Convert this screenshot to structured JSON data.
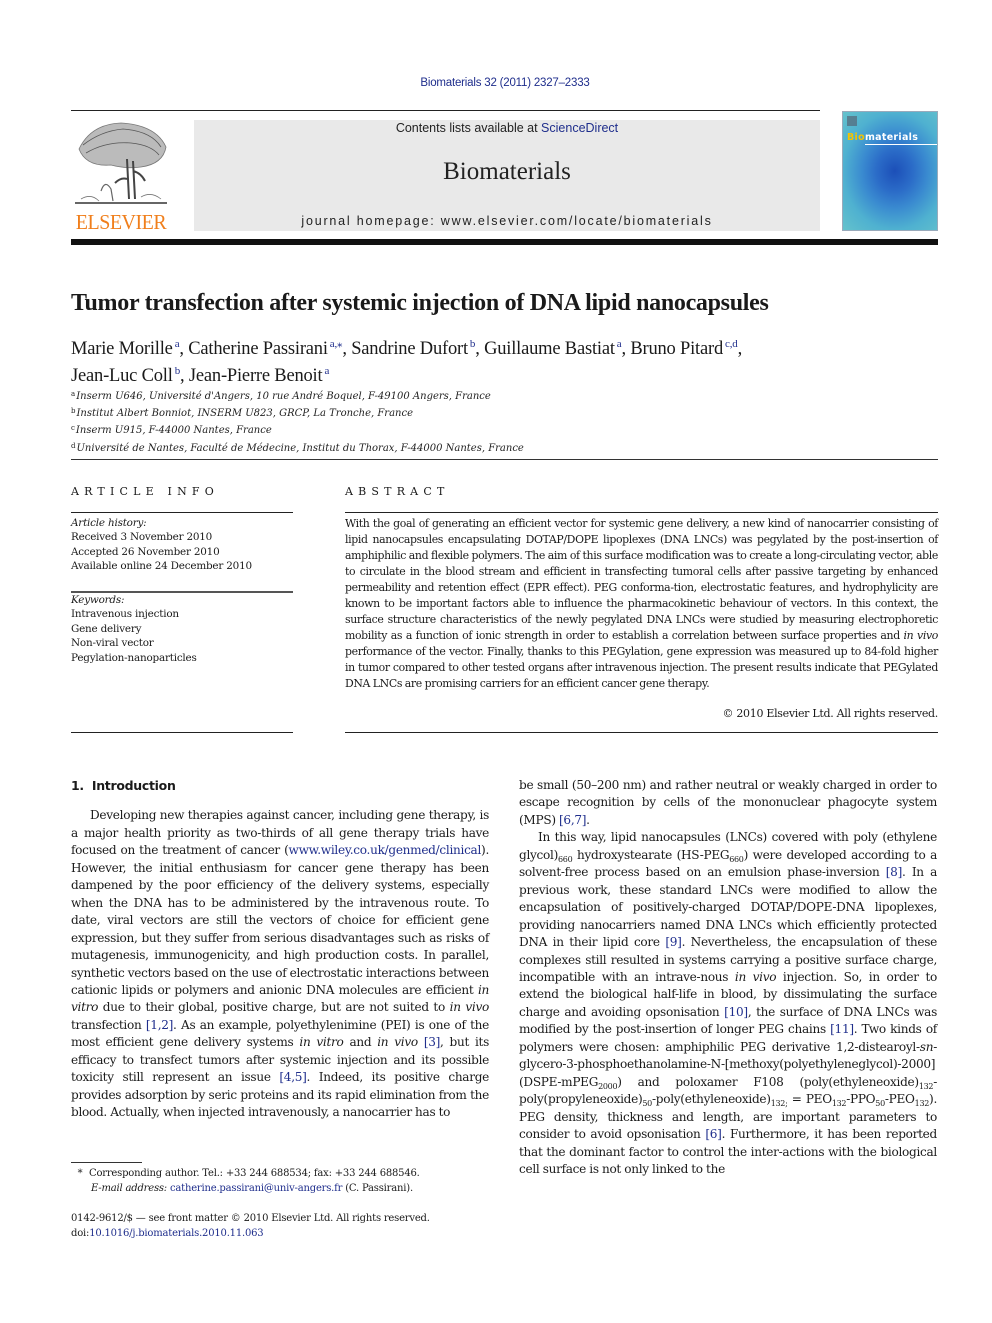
{
  "header": {
    "citation": "Biomaterials 32 (2011) 2327–2333",
    "contents_prefix": "Contents lists available at ",
    "contents_link": "ScienceDirect",
    "journal_name": "Biomaterials",
    "homepage_prefix": "journal homepage: ",
    "homepage_url": "www.elsevier.com/locate/biomaterials",
    "publisher_logo_text": "ELSEVIER",
    "cover_title_a": "Bio",
    "cover_title_b": "materials",
    "colors": {
      "publisher_orange": "#f07f1c",
      "link_blue": "#1f2e8c",
      "header_gray": "#e9e9e9",
      "cover_blue": "#2b6cc8"
    }
  },
  "article": {
    "title": "Tumor transfection after systemic injection of DNA lipid nanocapsules",
    "authors": [
      {
        "name": "Marie Morille",
        "aff": "a"
      },
      {
        "name": "Catherine Passirani",
        "aff": "a,⁎"
      },
      {
        "name": "Sandrine Dufort",
        "aff": "b"
      },
      {
        "name": "Guillaume Bastiat",
        "aff": "a"
      },
      {
        "name": "Bruno Pitard",
        "aff": "c,d"
      },
      {
        "name": "Jean-Luc Coll",
        "aff": "b"
      },
      {
        "name": "Jean-Pierre Benoit",
        "aff": "a"
      }
    ],
    "affiliations": [
      {
        "key": "a",
        "text": "Inserm U646, Université d'Angers, 10 rue André Boquel, F-49100 Angers, France"
      },
      {
        "key": "b",
        "text": "Institut Albert Bonniot, INSERM U823, GRCP, La Tronche, France"
      },
      {
        "key": "c",
        "text": "Inserm U915, F-44000 Nantes, France"
      },
      {
        "key": "d",
        "text": "Université de Nantes, Faculté de Médecine, Institut du Thorax, F-44000 Nantes, France"
      }
    ]
  },
  "article_info": {
    "heading": "ARTICLE INFO",
    "history_label": "Article history:",
    "history": [
      "Received 3 November 2010",
      "Accepted 26 November 2010",
      "Available online 24 December 2010"
    ],
    "keywords_label": "Keywords:",
    "keywords": [
      "Intravenous injection",
      "Gene delivery",
      "Non-viral vector",
      "Pegylation-nanoparticles"
    ]
  },
  "abstract": {
    "heading": "ABSTRACT",
    "text_1": "With the goal of generating an efficient vector for systemic gene delivery, a new kind of nanocarrier consisting of lipid nanocapsules encapsulating DOTAP/DOPE lipoplexes (DNA LNCs) was pegylated by the post-insertion of amphiphilic and flexible polymers. The aim of this surface modification was to create a long-circulating vector, able to circulate in the blood stream and efficient in transfecting tumoral cells after passive targeting by enhanced permeability and retention effect (EPR effect). PEG conforma-tion, electrostatic features, and hydrophylicity are known to be important factors able to influence the pharmacokinetic behaviour of vectors. In this context, the surface structure characteristics of the newly pegylated DNA LNCs were studied by measuring electrophoretic mobility as a function of ionic strength in order to establish a correlation between surface properties and ",
    "text_italic": "in vivo",
    "text_2": " performance of the vector. Finally, thanks to this PEGylation, gene expression was measured up to 84-fold higher in tumor compared to other tested organs after intravenous injection. The present results indicate that PEGylated DNA LNCs are promising carriers for an efficient cancer gene therapy.",
    "copyright": "© 2010 Elsevier Ltd. All rights reserved."
  },
  "intro": {
    "number": "1.",
    "heading": "Introduction",
    "left": {
      "t1": "Developing new therapies against cancer, including gene therapy, is a major health priority as two-thirds of all gene therapy trials have focused on the treatment of cancer (",
      "link1": "www.wiley.co.uk/genmed/clinical",
      "t2": "). However, the initial enthusiasm for cancer gene therapy has been dampened by the poor efficiency of the delivery systems, especially when the DNA has to be administered by the intravenous route. To date, viral vectors are still the vectors of choice for efficient gene expression, but they suffer from serious disadvantages such as risks of mutagenesis, immunogenicity, and high production costs. In parallel, synthetic vectors based on the use of electrostatic interactions between cationic lipids or polymers and anionic DNA molecules are efficient ",
      "i1": "in vitro",
      "t3": " due to their global, positive charge, but are not suited to ",
      "i2": "in vivo",
      "t4": " transfection ",
      "ref1": "[1,2]",
      "t5": ". As an example, polyethylenimine (PEI) is one of the most efficient gene delivery systems ",
      "i3": "in vitro",
      "t6": " and ",
      "i4": "in vivo",
      "t7": " ",
      "ref2": "[3]",
      "t8": ", but its efficacy to transfect tumors after systemic injection and its possible toxicity still represent an issue ",
      "ref3": "[4,5]",
      "t9": ". Indeed, its positive charge provides adsorption by seric proteins and its rapid elimination from the blood. Actually, when injected intravenously, a nanocarrier has to"
    },
    "right": {
      "p1_t1": "be small (50–200 nm) and rather neutral or weakly charged in order to escape recognition by cells of the mononuclear phagocyte system (MPS) ",
      "p1_ref": "[6,7]",
      "p1_t2": ".",
      "p2_t1": "In this way, lipid nanocapsules (LNCs) covered with poly (ethylene glycol)",
      "p2_s1": "660",
      "p2_t2": " hydroxystearate (HS-PEG",
      "p2_s2": "660",
      "p2_t3": ") were developed according to a solvent-free process based on an emulsion phase-inversion ",
      "p2_ref1": "[8]",
      "p2_t4": ". In a previous work, these standard LNCs were modified to allow the encapsulation of positively-charged DOTAP/DOPE-DNA lipoplexes, providing nanocarriers named DNA LNCs which efficiently protected DNA in their lipid core ",
      "p2_ref2": "[9]",
      "p2_t5": ". Nevertheless, the encapsulation of these complexes still resulted in systems carrying a positive surface charge, incompatible with an intrave-nous ",
      "p2_i1": "in vivo",
      "p2_t6": " injection. So, in order to extend the biological half-life in blood, by dissimulating the surface charge and avoiding opsonisation ",
      "p2_ref3": "[10]",
      "p2_t7": ", the surface of DNA LNCs was modified by the post-insertion of longer PEG chains ",
      "p2_ref4": "[11]",
      "p2_t8": ". Two kinds of polymers were chosen: amphiphilic PEG derivative 1,2-distearoyl-",
      "p2_i2": "sn",
      "p2_t9": "-glycero-3-phosphoethanolamine-N-[methoxy(polyethyleneglycol)-2000] (DSPE-mPEG",
      "p2_s3": "2000",
      "p2_t10": ") and poloxamer F108 (poly(ethyleneoxide)",
      "p2_s4": "132",
      "p2_t11": "-poly(propyleneoxide)",
      "p2_s5": "50",
      "p2_t12": "-poly(ethyleneoxide)",
      "p2_s6": "132;",
      "p2_t13": " = PEO",
      "p2_s7": "132",
      "p2_t14": "-PPO",
      "p2_s8": "50",
      "p2_t15": "-PEO",
      "p2_s9": "132",
      "p2_t16": "). PEG density, thickness and length, are important parameters to consider to avoid opsonisation ",
      "p2_ref5": "[6]",
      "p2_t17": ". Furthermore, it has been reported that the dominant factor to control the inter-actions with the biological cell surface is not only linked to the"
    }
  },
  "footnotes": {
    "star": "*",
    "corresponding": "Corresponding author. Tel.: +33 244 688534; fax: +33 244 688546.",
    "email_label": "E-mail address:",
    "email": "catherine.passirani@univ-angers.fr",
    "email_suffix": " (C. Passirani).",
    "issn": "0142-9612/$ — see front matter © 2010 Elsevier Ltd. All rights reserved.",
    "doi_label": "doi:",
    "doi": "10.1016/j.biomaterials.2010.11.063"
  }
}
